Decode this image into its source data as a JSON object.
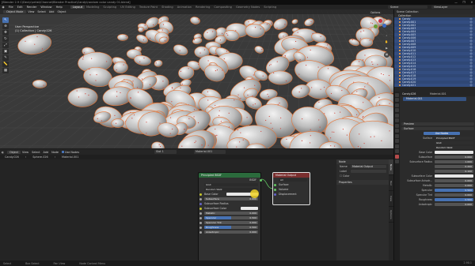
{
  "titlebar": {
    "title": "[Blender 2.9 C\\Dev\\c\\artist\\Channel\\Blender Practice\\Candy\\random color candy 01.blend]",
    "controls": [
      "—",
      "❐",
      "✕"
    ]
  },
  "menubar": {
    "menus": [
      "File",
      "Edit",
      "Render",
      "Window",
      "Help"
    ],
    "workspaces": [
      "Layout",
      "Modeling",
      "Sculpting",
      "UV Editing",
      "Texture Paint",
      "Shading",
      "Animation",
      "Rendering",
      "Compositing",
      "Geometry Nodes",
      "Scripting"
    ],
    "active_workspace": "Layout",
    "scene": "Scene",
    "view_layer": "ViewLayer"
  },
  "viewport": {
    "header": [
      "Object Mode",
      "View",
      "Select",
      "Add",
      "Object"
    ],
    "info_line1": "User Perspective",
    "info_line2": "(1) Collection | Candy.026",
    "options": "Options",
    "gizmo": {
      "x": "X",
      "y": "Y",
      "z": "Z"
    },
    "candy_color": "#d8d8d8",
    "outline_color": "#e8783a",
    "sprinkle_color": "#d2463c"
  },
  "node_editor": {
    "header": [
      "Object",
      "View",
      "Select",
      "Add",
      "Node"
    ],
    "use_nodes": "Use Nodes",
    "slot": "Slot 1",
    "material": "Material.001",
    "breadcrumb": [
      "Candy.026",
      "Sphere.026",
      "Material.001"
    ],
    "principled": {
      "title": "Principled BSDF",
      "output": "BSDF",
      "distribution": "GGX",
      "subsurface_method": "Random Walk",
      "base_color_label": "Base Color",
      "subsurface": {
        "label": "Subsurface",
        "value": "0.000"
      },
      "subsurface_radius": "Subsurface Radius",
      "subsurface_color": "Subsurface Color",
      "metallic": {
        "label": "Metallic",
        "value": "0.000",
        "fill": 0.0
      },
      "specular": {
        "label": "Specular",
        "value": "0.500",
        "fill": 0.5
      },
      "specular_tint": {
        "label": "Specular Tint",
        "value": "0.000",
        "fill": 0.0
      },
      "roughness": {
        "label": "Roughness",
        "value": "0.500",
        "fill": 0.5
      },
      "anisotropic": {
        "label": "Anisotropic",
        "value": "0.000",
        "fill": 0.0
      }
    },
    "material_output": {
      "title": "Material Output",
      "target": "All",
      "inputs": [
        "Surface",
        "Volume",
        "Displacement"
      ]
    },
    "sidebar": {
      "node_header": "Node",
      "name_label": "Name",
      "name_value": "Material Output",
      "label_label": "Label",
      "color_label": "Color",
      "properties_header": "Properties"
    },
    "tabs": [
      "Node",
      "Tool",
      "View",
      "Options"
    ]
  },
  "outliner": {
    "header": "Scene Collection",
    "collection": "Collection",
    "items": [
      "Candy",
      "Candy.001",
      "Candy.002",
      "Candy.003",
      "Candy.004",
      "Candy.005",
      "Candy.006",
      "Candy.007",
      "Candy.008",
      "Candy.009",
      "Candy.010",
      "Candy.011",
      "Candy.012",
      "Candy.013",
      "Candy.014",
      "Candy.015",
      "Candy.016",
      "Candy.017",
      "Candy.018",
      "Candy.019",
      "Candy.020",
      "Candy.021"
    ]
  },
  "properties": {
    "object": "Candy.026",
    "material": "Material.001",
    "slot_item": "Material.001",
    "preview": "Preview",
    "surface_section": "Surface",
    "use_nodes": "Use Nodes",
    "surface_label": "Surface",
    "surface_value": "Principled BSDF",
    "distribution": "GGX",
    "subsurface_method": "Random Walk",
    "rows": [
      {
        "label": "Base Color",
        "kind": "white",
        "value": ""
      },
      {
        "label": "Subsurface",
        "kind": "num",
        "value": "0.000"
      },
      {
        "label": "Subsurface Radius",
        "kind": "num",
        "value": "1.000"
      },
      {
        "label": "",
        "kind": "num",
        "value": "0.200"
      },
      {
        "label": "",
        "kind": "num",
        "value": "0.100"
      },
      {
        "label": "Subsurface Color",
        "kind": "white",
        "value": ""
      },
      {
        "label": "Subsurface Anisotr...",
        "kind": "num",
        "value": "0.000"
      },
      {
        "label": "Metallic",
        "kind": "num",
        "value": "0.000"
      },
      {
        "label": "Specular",
        "kind": "blue",
        "value": "0.500"
      },
      {
        "label": "Specular Tint",
        "kind": "num",
        "value": "0.000"
      },
      {
        "label": "Roughness",
        "kind": "blue",
        "value": "0.500"
      },
      {
        "label": "Anisotropic",
        "kind": "num",
        "value": "0.000"
      }
    ]
  },
  "statusbar": {
    "items": [
      "Select",
      "Box Select",
      "Pan View",
      "Node Context Menu"
    ],
    "version": "2.90.1"
  }
}
